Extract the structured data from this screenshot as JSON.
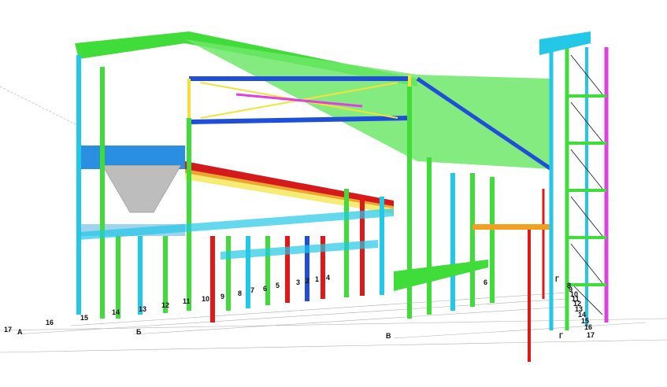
{
  "viewport": {
    "title": ""
  },
  "grid_labels": {
    "rows_left": [
      "17",
      "16",
      "15",
      "14",
      "13",
      "12",
      "11",
      "10",
      "9",
      "8",
      "7",
      "6",
      "5",
      "3",
      "2",
      "1",
      "4"
    ],
    "axes": [
      "А",
      "Б",
      "В",
      "Г",
      "Г"
    ],
    "rows_right": [
      "17",
      "16",
      "15",
      "14",
      "13",
      "12",
      "11",
      "10",
      "9",
      "8",
      "6"
    ]
  },
  "colors": {
    "column_green": "#3fdc3a",
    "beam_blue": "#1f4fd8",
    "brace_cyan": "#22c8e6",
    "beam_yellow": "#f2e23a",
    "beam_red": "#e01818",
    "beam_magenta": "#e040e0",
    "deck_grey": "#c8c8c8"
  }
}
